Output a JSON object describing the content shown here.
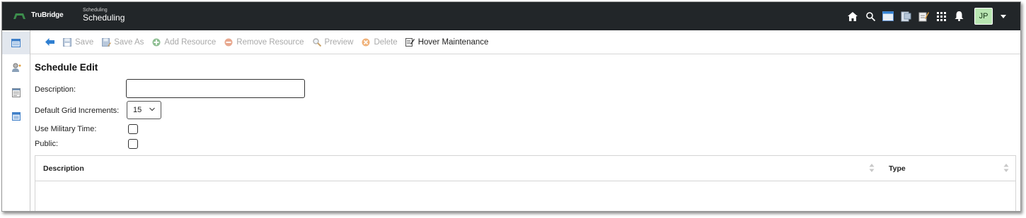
{
  "header": {
    "logo_text": "TruBridge",
    "module_subtitle": "Scheduling",
    "module_title": "Scheduling",
    "avatar_initials": "JP",
    "icons": [
      "home-icon",
      "search-icon",
      "window-icon",
      "document-icon",
      "notes-icon",
      "apps-grid-icon",
      "bell-icon"
    ]
  },
  "sidebar": {
    "items": [
      "calendar-icon",
      "doctor-icon",
      "schedule-list-icon",
      "grid-view-icon"
    ]
  },
  "toolbar": {
    "back_icon": "back-arrow-icon",
    "save": "Save",
    "save_as": "Save As",
    "add_resource": "Add Resource",
    "remove_resource": "Remove Resource",
    "preview": "Preview",
    "delete": "Delete",
    "hover_maintenance": "Hover Maintenance"
  },
  "form": {
    "title": "Schedule Edit",
    "description_label": "Description:",
    "description_value": "",
    "grid_increments_label": "Default Grid Increments:",
    "grid_increments_value": "15",
    "military_time_label": "Use Military Time:",
    "military_time_checked": false,
    "public_label": "Public:",
    "public_checked": false
  },
  "table": {
    "columns": [
      "Description",
      "Type"
    ],
    "rows": []
  },
  "colors": {
    "header_bg": "#222629",
    "avatar_bg": "#b9e6b2",
    "accent_blue": "#2f7fd1",
    "disabled_text": "#a9a9a9"
  }
}
